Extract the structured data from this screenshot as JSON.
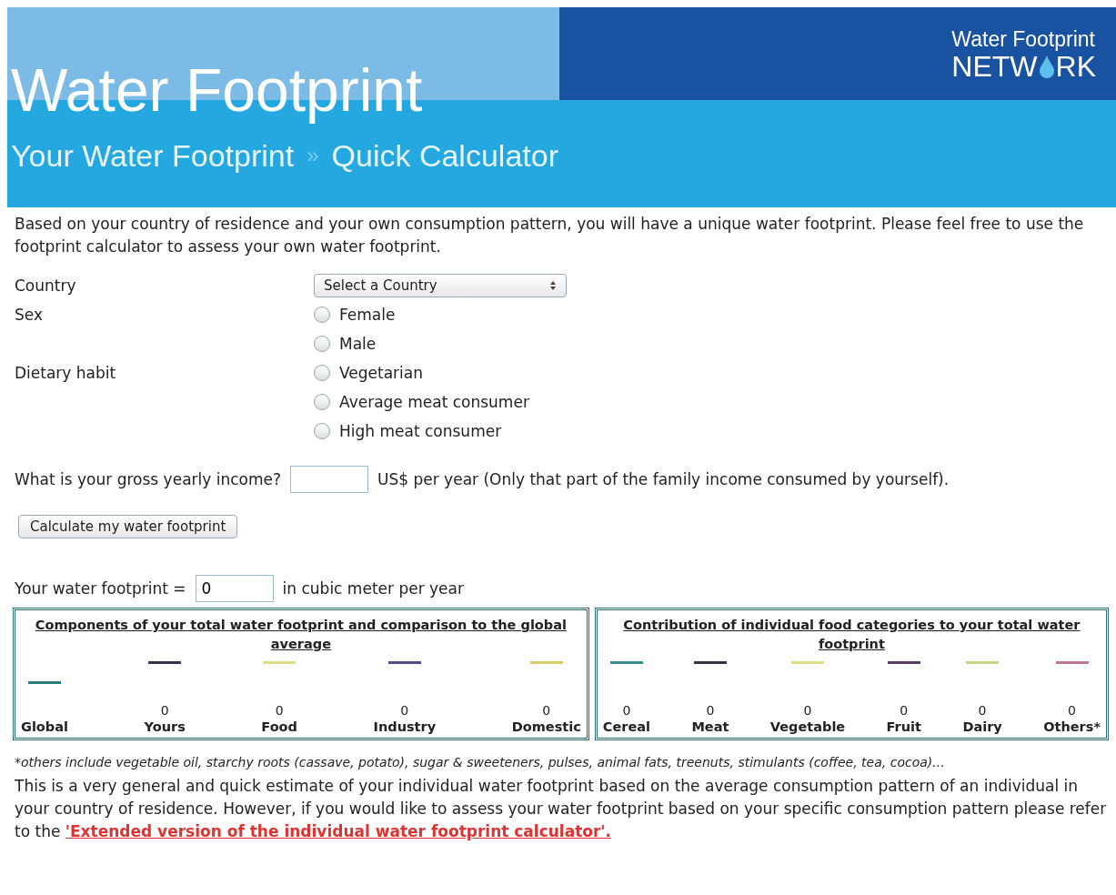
{
  "header": {
    "title": "Water Footprint",
    "logo_top": "Water Footprint",
    "logo_bottom_left": "NETW",
    "logo_bottom_right": "RK",
    "breadcrumb": [
      "Your Water Footprint",
      "Quick Calculator"
    ],
    "separator": "»"
  },
  "intro": "Based on your country of residence and your own consumption pattern, you will have a unique water footprint. Please feel free to use the footprint calculator to assess your own water footprint.",
  "country": {
    "label": "Country",
    "value": "Select a Country"
  },
  "sex": {
    "label": "Sex",
    "options": [
      {
        "label": "Female",
        "selected": false
      },
      {
        "label": "Male",
        "selected": false
      }
    ]
  },
  "diet": {
    "label": "Dietary habit",
    "options": [
      {
        "label": "Vegetarian",
        "selected": false
      },
      {
        "label": "Average meat consumer",
        "selected": false
      },
      {
        "label": "High meat consumer",
        "selected": false
      }
    ]
  },
  "income": {
    "label": "What is your gross yearly income?",
    "suffix": "US$ per year (Only that part of the family income consumed by yourself)."
  },
  "calculate_button": "Calculate my water footprint",
  "result": {
    "label": "Your water footprint =",
    "value": "0",
    "unit": "in cubic meter per year"
  },
  "panels": [
    {
      "title": "Components of your total water footprint and comparison to the global average",
      "items": [
        {
          "label": "Global",
          "value": "",
          "color": "#2a7c7a",
          "raised": false
        },
        {
          "label": "Yours",
          "value": "0",
          "color": "#33334a",
          "raised": true
        },
        {
          "label": "Food",
          "value": "0",
          "color": "#dede80",
          "raised": true
        },
        {
          "label": "Industry",
          "value": "0",
          "color": "#5a4a86",
          "raised": true
        },
        {
          "label": "Domestic",
          "value": "0",
          "color": "#d8cc66",
          "raised": true
        }
      ]
    },
    {
      "title": "Contribution of individual food categories to your total water footprint",
      "items": [
        {
          "label": "Cereal",
          "value": "0",
          "color": "#3a8c8a",
          "raised": true
        },
        {
          "label": "Meat",
          "value": "0",
          "color": "#333344",
          "raised": true
        },
        {
          "label": "Vegetable",
          "value": "0",
          "color": "#dede80",
          "raised": true
        },
        {
          "label": "Fruit",
          "value": "0",
          "color": "#5a3a66",
          "raised": true
        },
        {
          "label": "Dairy",
          "value": "0",
          "color": "#c8d488",
          "raised": true
        },
        {
          "label": "Others*",
          "value": "0",
          "color": "#c07898",
          "raised": true
        }
      ]
    }
  ],
  "footnote": "*others include vegetable oil, starchy roots (cassave, potato), sugar & sweeteners, pulses, animal fats, treenuts, stimulants (coffee, tea, cocoa)...",
  "closing": "This is a very general and quick estimate of your individual water footprint based on the average consumption pattern of an individual in your country of residence. However, if you would like to assess your water footprint based on your specific consumption pattern please refer to the ",
  "closing_link": "'Extended version of the individual water footprint calculator'."
}
